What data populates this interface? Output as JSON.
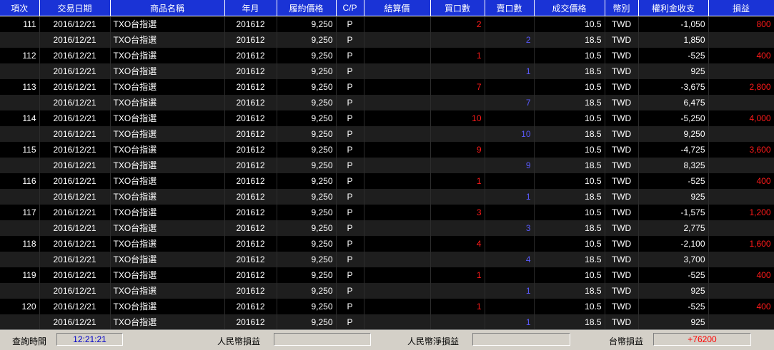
{
  "columns": [
    "項次",
    "交易日期",
    "商品名稱",
    "年月",
    "履約價格",
    "C/P",
    "結算價",
    "買口數",
    "賣口數",
    "成交價格",
    "幣別",
    "權利金收支",
    "損益"
  ],
  "rows": [
    {
      "item": "111",
      "date": "2016/12/21",
      "product": "TXO台指選",
      "ym": "201612",
      "strike": "9,250",
      "cp": "P",
      "settle": "",
      "buy": "2",
      "sell": "",
      "price": "10.5",
      "currency": "TWD",
      "premium": "-1,050",
      "pnl": "800"
    },
    {
      "item": "",
      "date": "2016/12/21",
      "product": "TXO台指選",
      "ym": "201612",
      "strike": "9,250",
      "cp": "P",
      "settle": "",
      "buy": "",
      "sell": "2",
      "price": "18.5",
      "currency": "TWD",
      "premium": "1,850",
      "pnl": ""
    },
    {
      "item": "112",
      "date": "2016/12/21",
      "product": "TXO台指選",
      "ym": "201612",
      "strike": "9,250",
      "cp": "P",
      "settle": "",
      "buy": "1",
      "sell": "",
      "price": "10.5",
      "currency": "TWD",
      "premium": "-525",
      "pnl": "400"
    },
    {
      "item": "",
      "date": "2016/12/21",
      "product": "TXO台指選",
      "ym": "201612",
      "strike": "9,250",
      "cp": "P",
      "settle": "",
      "buy": "",
      "sell": "1",
      "price": "18.5",
      "currency": "TWD",
      "premium": "925",
      "pnl": ""
    },
    {
      "item": "113",
      "date": "2016/12/21",
      "product": "TXO台指選",
      "ym": "201612",
      "strike": "9,250",
      "cp": "P",
      "settle": "",
      "buy": "7",
      "sell": "",
      "price": "10.5",
      "currency": "TWD",
      "premium": "-3,675",
      "pnl": "2,800"
    },
    {
      "item": "",
      "date": "2016/12/21",
      "product": "TXO台指選",
      "ym": "201612",
      "strike": "9,250",
      "cp": "P",
      "settle": "",
      "buy": "",
      "sell": "7",
      "price": "18.5",
      "currency": "TWD",
      "premium": "6,475",
      "pnl": ""
    },
    {
      "item": "114",
      "date": "2016/12/21",
      "product": "TXO台指選",
      "ym": "201612",
      "strike": "9,250",
      "cp": "P",
      "settle": "",
      "buy": "10",
      "sell": "",
      "price": "10.5",
      "currency": "TWD",
      "premium": "-5,250",
      "pnl": "4,000"
    },
    {
      "item": "",
      "date": "2016/12/21",
      "product": "TXO台指選",
      "ym": "201612",
      "strike": "9,250",
      "cp": "P",
      "settle": "",
      "buy": "",
      "sell": "10",
      "price": "18.5",
      "currency": "TWD",
      "premium": "9,250",
      "pnl": ""
    },
    {
      "item": "115",
      "date": "2016/12/21",
      "product": "TXO台指選",
      "ym": "201612",
      "strike": "9,250",
      "cp": "P",
      "settle": "",
      "buy": "9",
      "sell": "",
      "price": "10.5",
      "currency": "TWD",
      "premium": "-4,725",
      "pnl": "3,600"
    },
    {
      "item": "",
      "date": "2016/12/21",
      "product": "TXO台指選",
      "ym": "201612",
      "strike": "9,250",
      "cp": "P",
      "settle": "",
      "buy": "",
      "sell": "9",
      "price": "18.5",
      "currency": "TWD",
      "premium": "8,325",
      "pnl": ""
    },
    {
      "item": "116",
      "date": "2016/12/21",
      "product": "TXO台指選",
      "ym": "201612",
      "strike": "9,250",
      "cp": "P",
      "settle": "",
      "buy": "1",
      "sell": "",
      "price": "10.5",
      "currency": "TWD",
      "premium": "-525",
      "pnl": "400"
    },
    {
      "item": "",
      "date": "2016/12/21",
      "product": "TXO台指選",
      "ym": "201612",
      "strike": "9,250",
      "cp": "P",
      "settle": "",
      "buy": "",
      "sell": "1",
      "price": "18.5",
      "currency": "TWD",
      "premium": "925",
      "pnl": ""
    },
    {
      "item": "117",
      "date": "2016/12/21",
      "product": "TXO台指選",
      "ym": "201612",
      "strike": "9,250",
      "cp": "P",
      "settle": "",
      "buy": "3",
      "sell": "",
      "price": "10.5",
      "currency": "TWD",
      "premium": "-1,575",
      "pnl": "1,200"
    },
    {
      "item": "",
      "date": "2016/12/21",
      "product": "TXO台指選",
      "ym": "201612",
      "strike": "9,250",
      "cp": "P",
      "settle": "",
      "buy": "",
      "sell": "3",
      "price": "18.5",
      "currency": "TWD",
      "premium": "2,775",
      "pnl": ""
    },
    {
      "item": "118",
      "date": "2016/12/21",
      "product": "TXO台指選",
      "ym": "201612",
      "strike": "9,250",
      "cp": "P",
      "settle": "",
      "buy": "4",
      "sell": "",
      "price": "10.5",
      "currency": "TWD",
      "premium": "-2,100",
      "pnl": "1,600"
    },
    {
      "item": "",
      "date": "2016/12/21",
      "product": "TXO台指選",
      "ym": "201612",
      "strike": "9,250",
      "cp": "P",
      "settle": "",
      "buy": "",
      "sell": "4",
      "price": "18.5",
      "currency": "TWD",
      "premium": "3,700",
      "pnl": ""
    },
    {
      "item": "119",
      "date": "2016/12/21",
      "product": "TXO台指選",
      "ym": "201612",
      "strike": "9,250",
      "cp": "P",
      "settle": "",
      "buy": "1",
      "sell": "",
      "price": "10.5",
      "currency": "TWD",
      "premium": "-525",
      "pnl": "400"
    },
    {
      "item": "",
      "date": "2016/12/21",
      "product": "TXO台指選",
      "ym": "201612",
      "strike": "9,250",
      "cp": "P",
      "settle": "",
      "buy": "",
      "sell": "1",
      "price": "18.5",
      "currency": "TWD",
      "premium": "925",
      "pnl": ""
    },
    {
      "item": "120",
      "date": "2016/12/21",
      "product": "TXO台指選",
      "ym": "201612",
      "strike": "9,250",
      "cp": "P",
      "settle": "",
      "buy": "1",
      "sell": "",
      "price": "10.5",
      "currency": "TWD",
      "premium": "-525",
      "pnl": "400"
    },
    {
      "item": "",
      "date": "2016/12/21",
      "product": "TXO台指選",
      "ym": "201612",
      "strike": "9,250",
      "cp": "P",
      "settle": "",
      "buy": "",
      "sell": "1",
      "price": "18.5",
      "currency": "TWD",
      "premium": "925",
      "pnl": ""
    }
  ],
  "status": {
    "query_time_label": "查詢時間",
    "query_time": "12:21:21",
    "rmb_pnl_label": "人民幣損益",
    "rmb_pnl": "",
    "rmb_net_pnl_label": "人民幣淨損益",
    "rmb_net_pnl": "",
    "twd_pnl_label": "台幣損益",
    "twd_pnl": "+76200"
  },
  "colors": {
    "header_bg": "#1a33d6",
    "buy_color": "#ff1a1a",
    "sell_color": "#5a5aff",
    "pnl_color": "#ff1a1a",
    "twd_pnl_color": "#ff0000"
  }
}
